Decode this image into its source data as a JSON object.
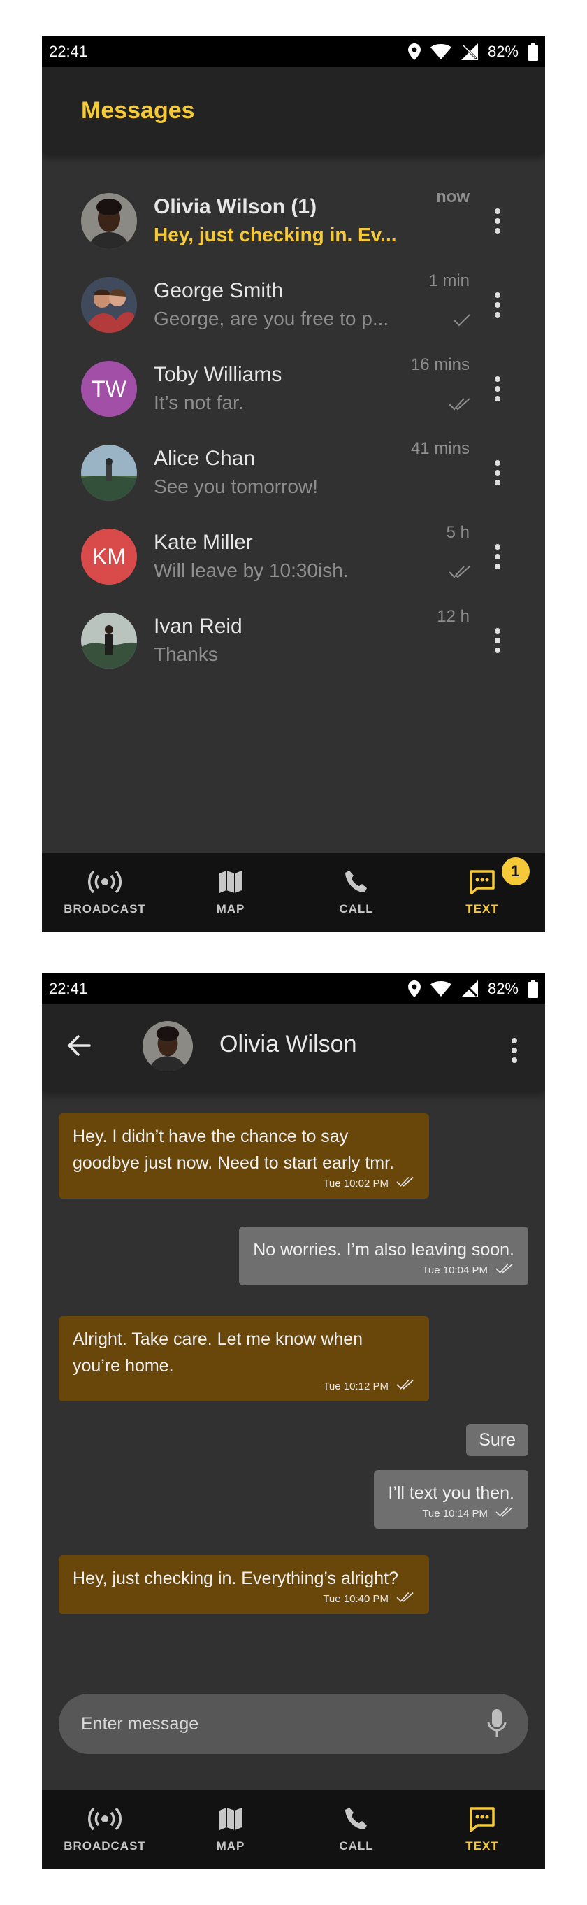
{
  "status": {
    "time": "22:41",
    "battery": "82%"
  },
  "inbox": {
    "title": "Messages",
    "conversations": [
      {
        "name": "Olivia Wilson (1)",
        "preview": "Hey, just checking in. Ev...",
        "time": "now",
        "unread": true,
        "avatar": "photo"
      },
      {
        "name": "George Smith",
        "preview": "George, are you free to p...",
        "time": "1 min",
        "tick": "single",
        "avatar": "photo"
      },
      {
        "name": "Toby Williams",
        "preview": "It’s not far.",
        "time": "16 mins",
        "tick": "double",
        "avatar": "TW",
        "avatar_color": "#a24fa8"
      },
      {
        "name": "Alice Chan",
        "preview": "See you tomorrow!",
        "time": "41 mins",
        "avatar": "photo"
      },
      {
        "name": "Kate Miller",
        "preview": "Will leave by 10:30ish.",
        "time": "5 h",
        "tick": "double",
        "avatar": "KM",
        "avatar_color": "#d94b4b"
      },
      {
        "name": "Ivan Reid",
        "preview": "Thanks",
        "time": "12 h",
        "avatar": "photo"
      }
    ]
  },
  "nav": {
    "broadcast": "BROADCAST",
    "map": "MAP",
    "call": "CALL",
    "text": "TEXT",
    "text_badge": "1"
  },
  "chat": {
    "contact": "Olivia Wilson",
    "messages": [
      {
        "dir": "in",
        "line1": "Hey. I didn’t have the chance to say",
        "line2": "goodbye just now. Need to start early tmr.",
        "time": "Tue 10:02 PM"
      },
      {
        "dir": "out",
        "line1": "No worries. I’m also leaving soon.",
        "time": "Tue 10:04 PM"
      },
      {
        "dir": "in",
        "line1": "Alright. Take care. Let me know when",
        "line2": "you’re home.",
        "time": "Tue 10:12 PM"
      },
      {
        "dir": "out",
        "line1": "Sure"
      },
      {
        "dir": "out",
        "line1": "I’ll text you then.",
        "time": "Tue 10:14 PM"
      },
      {
        "dir": "in",
        "line1": "Hey, just checking in. Everything’s alright?",
        "time": "Tue 10:40 PM"
      }
    ],
    "input_placeholder": "Enter message"
  },
  "colors": {
    "accent": "#f5c938",
    "incoming_bubble": "#694609",
    "outgoing_bubble": "#6f6f6f"
  },
  "icons": [
    "location-icon",
    "wifi-icon",
    "signal-icon",
    "battery-icon",
    "more-vert-icon",
    "check-icon",
    "double-check-icon",
    "broadcast-icon",
    "map-icon",
    "phone-icon",
    "chat-icon",
    "back-arrow-icon",
    "mic-icon"
  ]
}
